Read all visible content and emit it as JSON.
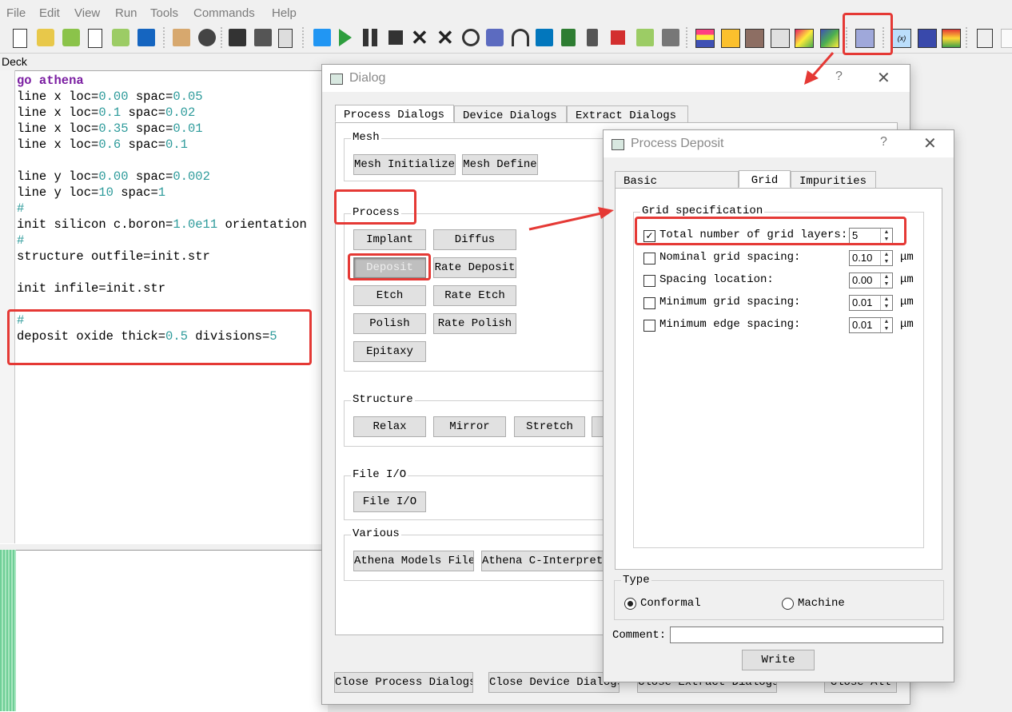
{
  "menu": [
    "File",
    "Edit",
    "View",
    "Run",
    "Tools",
    "Commands",
    "Help"
  ],
  "deck_label": "Deck",
  "code": {
    "l1": {
      "kw": "go athena"
    },
    "l2": {
      "a": "line x loc=",
      "b": "0.00",
      "c": " spac=",
      "d": "0.05"
    },
    "l3": {
      "a": "line x loc=",
      "b": "0.1",
      "c": " spac=",
      "d": "0.02"
    },
    "l4": {
      "a": "line x loc=",
      "b": "0.35",
      "c": " spac=",
      "d": "0.01"
    },
    "l5": {
      "a": "line x loc=",
      "b": "0.6",
      "c": " spac=",
      "d": "0.1"
    },
    "l6": {
      "a": "line y loc=",
      "b": "0.00",
      "c": " spac=",
      "d": "0.002"
    },
    "l7": {
      "a": "line y loc=",
      "b": "10",
      "c": " spac=",
      "d": "1"
    },
    "l8": "#",
    "l9": {
      "a": "init silicon c.boron=",
      "b": "1.0e11",
      "c": " orientation"
    },
    "l10": "#",
    "l11": "structure outfile=init.str",
    "l12": "init infile=init.str",
    "l13": "#",
    "l14": {
      "a": "deposit oxide thick=",
      "b": "0.5",
      "c": " divisions=",
      "d": "5"
    }
  },
  "dialog": {
    "title": "Dialog",
    "help": "?",
    "close": "✕",
    "tabs": [
      "Process Dialogs",
      "Device Dialogs",
      "Extract Dialogs"
    ],
    "mesh": {
      "title": "Mesh",
      "buttons": [
        "Mesh Initialize",
        "Mesh Define"
      ]
    },
    "process": {
      "title": "Process",
      "buttons": [
        "Implant",
        "Diffus",
        "Deposit",
        "Rate Deposit",
        "Etch",
        "Rate Etch",
        "Polish",
        "Rate Polish",
        "Epitaxy"
      ]
    },
    "structure": {
      "title": "Structure",
      "buttons": [
        "Relax",
        "Mirror",
        "Stretch"
      ]
    },
    "fileio": {
      "title": "File I/O",
      "buttons": [
        "File I/O"
      ]
    },
    "various": {
      "title": "Various",
      "buttons": [
        "Athena Models File",
        "Athena C-Interprete"
      ]
    },
    "footer": [
      "Close Process Dialogs",
      "Close Device Dialogs",
      "Close Extract Dialogs",
      "Close All"
    ]
  },
  "deposit": {
    "title": "Process Deposit",
    "help": "?",
    "close": "✕",
    "tabs": [
      "Basic Parameters",
      "Grid",
      "Impurities"
    ],
    "grid_title": "Grid specification",
    "rows": [
      {
        "label": "Total number of grid layers:",
        "checked": true,
        "value": "5",
        "unit": ""
      },
      {
        "label": "Nominal grid spacing:",
        "checked": false,
        "value": "0.10",
        "unit": "μm"
      },
      {
        "label": "Spacing location:",
        "checked": false,
        "value": "0.00",
        "unit": "μm"
      },
      {
        "label": "Minimum grid spacing:",
        "checked": false,
        "value": "0.01",
        "unit": "μm"
      },
      {
        "label": "Minimum edge spacing:",
        "checked": false,
        "value": "0.01",
        "unit": "μm"
      }
    ],
    "type_title": "Type",
    "type_options": [
      "Conformal",
      "Machine"
    ],
    "type_selected": "Conformal",
    "comment_label": "Comment:",
    "comment_value": "",
    "write": "Write"
  },
  "colors": {
    "highlight": "#e53935",
    "keyword": "#7b1fa2",
    "number": "#2e9b9b"
  }
}
